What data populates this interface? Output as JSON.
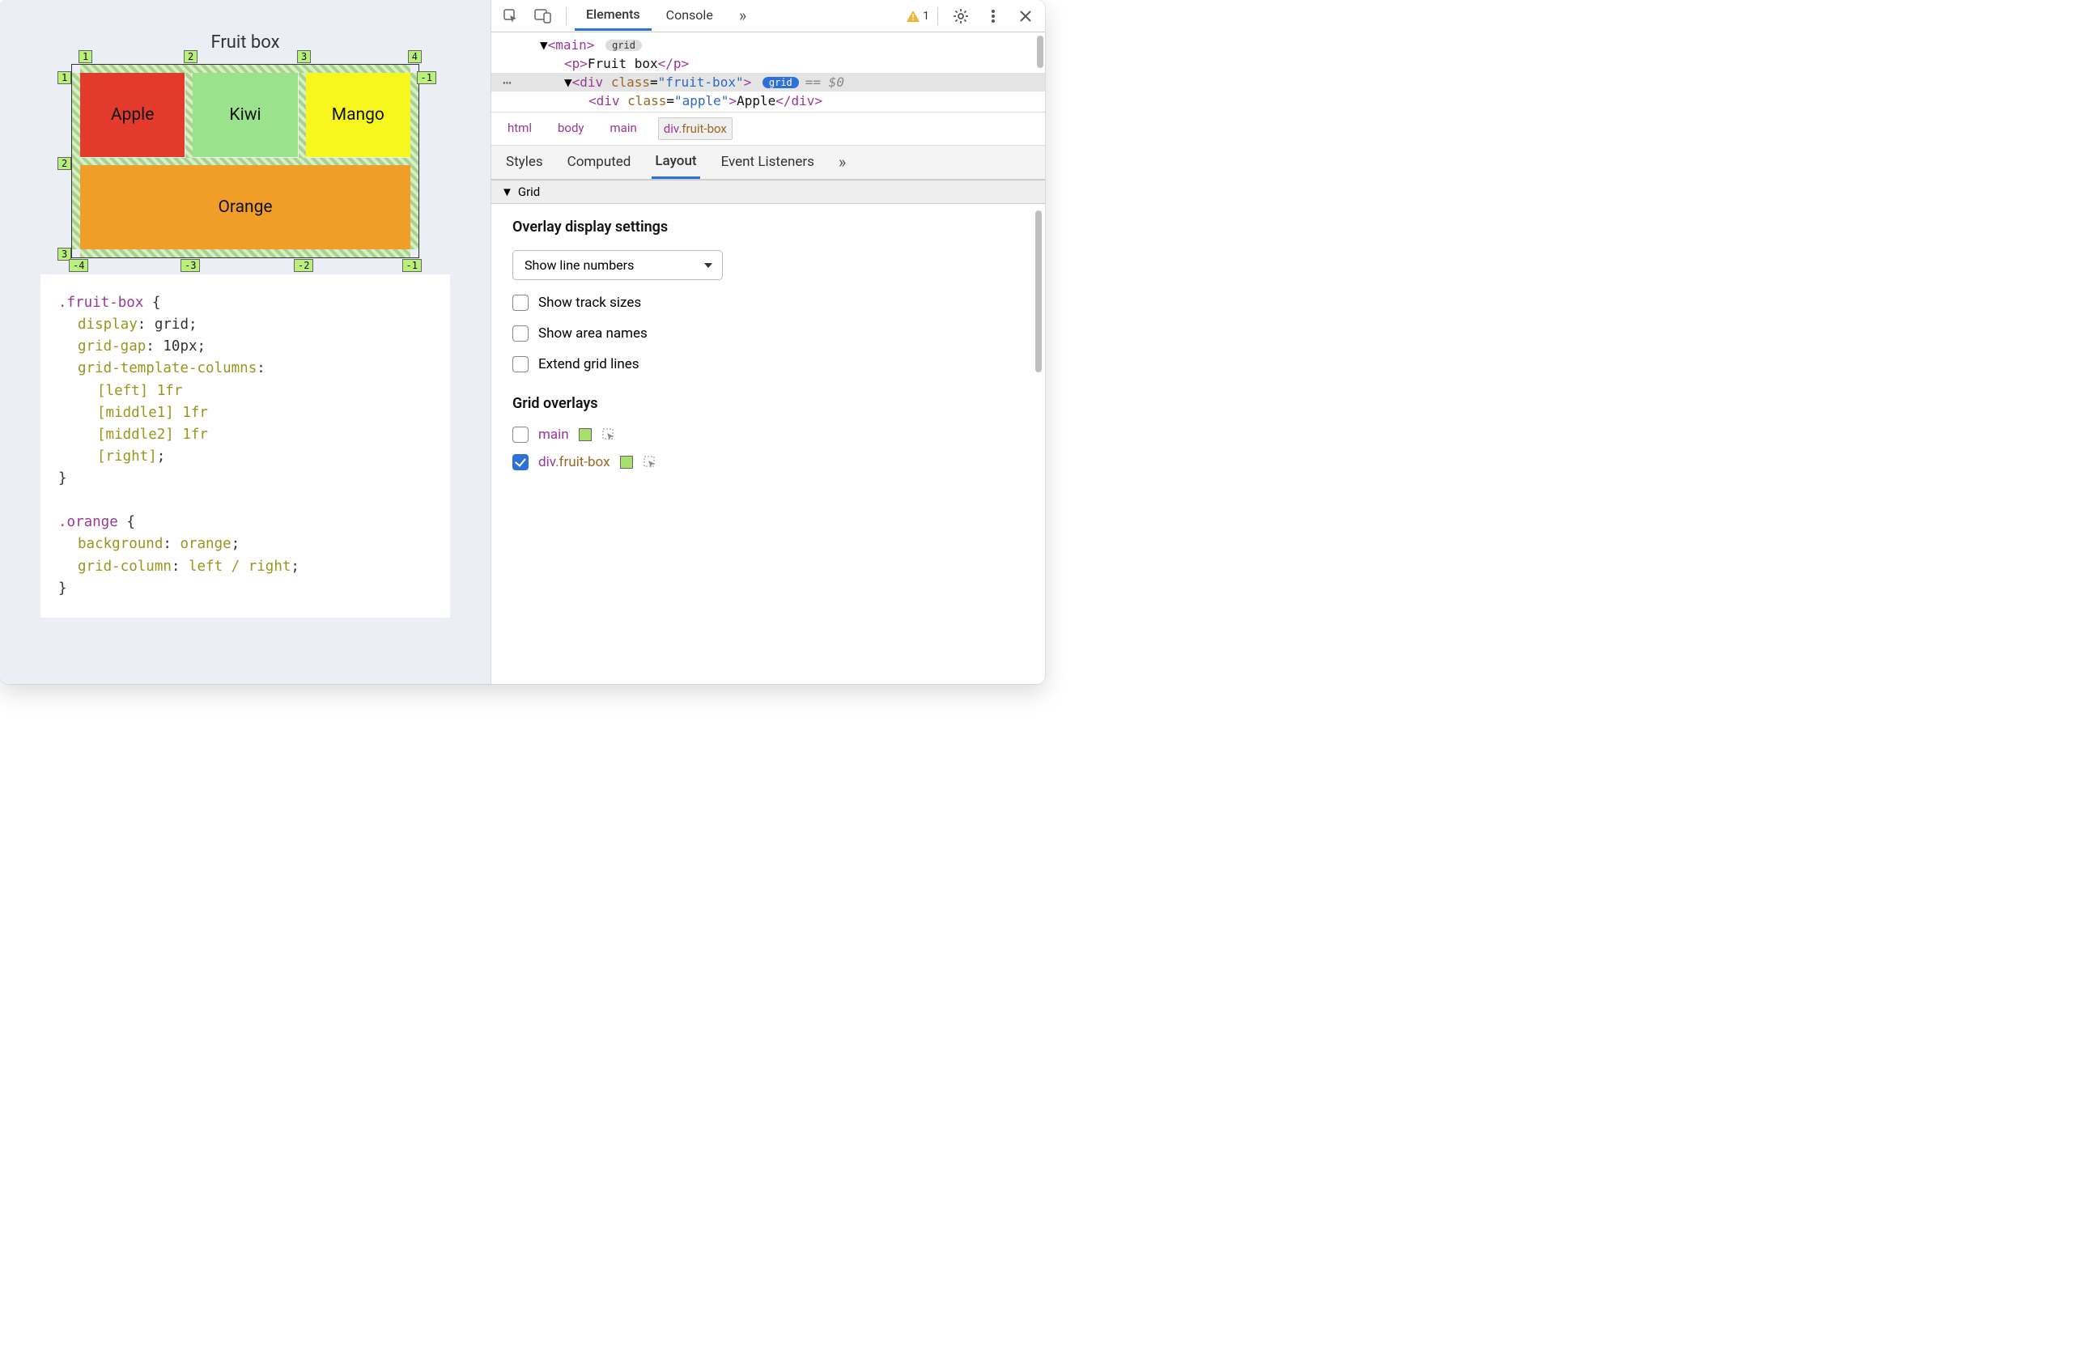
{
  "viewport": {
    "title": "Fruit box",
    "cells": {
      "apple": "Apple",
      "kiwi": "Kiwi",
      "mango": "Mango",
      "orange": "Orange"
    },
    "line_numbers": {
      "top": [
        "1",
        "2",
        "3",
        "4"
      ],
      "bottom": [
        "-4",
        "-3",
        "-2",
        "-1"
      ],
      "left": [
        "1",
        "2",
        "3"
      ],
      "right": [
        "-1"
      ]
    }
  },
  "code": {
    "rule1": {
      "selector": ".fruit-box",
      "decls": [
        {
          "prop": "display",
          "val": "grid"
        },
        {
          "prop": "grid-gap",
          "val": "10px"
        },
        {
          "prop": "grid-template-columns",
          "lines": [
            "[left] 1fr",
            "[middle1] 1fr",
            "[middle2] 1fr",
            "[right]"
          ]
        }
      ]
    },
    "rule2": {
      "selector": ".orange",
      "decls": [
        {
          "prop": "background",
          "val": "orange"
        },
        {
          "prop": "grid-column",
          "val": "left / right"
        }
      ]
    }
  },
  "devtools": {
    "tabs": {
      "elements": "Elements",
      "console": "Console"
    },
    "more": "»",
    "warning_count": "1",
    "dom": {
      "main_open": "<main>",
      "main_badge": "grid",
      "p_line": {
        "open": "<p>",
        "text": "Fruit box",
        "close": "</p>"
      },
      "sel_line": {
        "open": "<div ",
        "attr": "class",
        "eq": "=",
        "val": "\"fruit-box\"",
        "close": ">",
        "badge": "grid",
        "suffix": "== $0"
      },
      "child_line": {
        "open": "<div ",
        "attr": "class",
        "eq": "=",
        "val": "\"apple\"",
        "close": ">",
        "text": "Apple",
        "close2": "</div>"
      }
    },
    "breadcrumb": [
      "html",
      "body",
      "main",
      "div.fruit-box"
    ],
    "subtabs": {
      "styles": "Styles",
      "computed": "Computed",
      "layout": "Layout",
      "listeners": "Event Listeners",
      "more": "»"
    },
    "grid_section": {
      "title": "Grid",
      "overlay_heading": "Overlay display settings",
      "dropdown": "Show line numbers",
      "checks": [
        "Show track sizes",
        "Show area names",
        "Extend grid lines"
      ],
      "overlays_heading": "Grid overlays",
      "overlays": [
        {
          "checked": false,
          "label": "main",
          "swatch": "#a7e06b"
        },
        {
          "checked": true,
          "label": "div.fruit-box",
          "swatch": "#a7e06b"
        }
      ]
    }
  }
}
